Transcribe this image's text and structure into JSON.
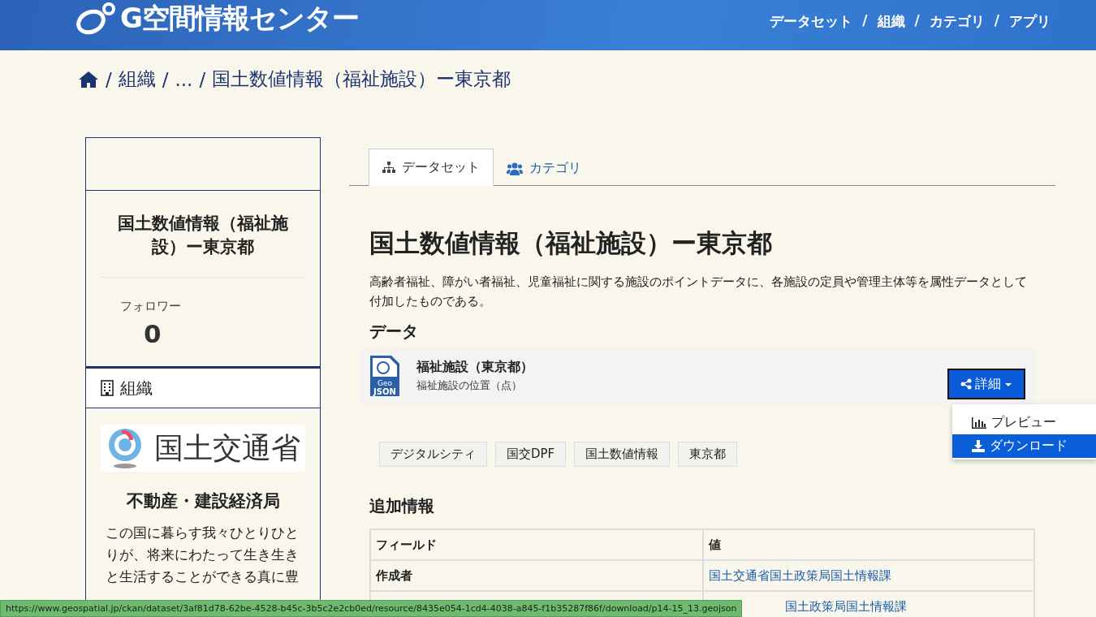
{
  "header": {
    "logo_text": "G空間情報センター",
    "nav": [
      "データセット",
      "組織",
      "カテゴリ",
      "アプリ"
    ],
    "separator": "/"
  },
  "breadcrumb": {
    "separator": "/",
    "items": [
      "組織",
      "...",
      "国土数値情報（福祉施設）ー東京都"
    ]
  },
  "sidebar": {
    "title": "国土数値情報（福祉施設）ー東京都",
    "followers_label": "フォロワー",
    "followers_count": "0",
    "org_heading": "組織",
    "org_logo_text": "国土交通省",
    "org_name": "不動産・建設経済局",
    "org_description": "この国に暮らす我々ひとりひとりが、将来にわたって生き生きと生活することができる真に豊"
  },
  "tabs": [
    {
      "label": "データセット",
      "selected": true,
      "kind": "dataset"
    },
    {
      "label": "カテゴリ",
      "selected": false,
      "kind": "category"
    }
  ],
  "dataset": {
    "title": "国土数値情報（福祉施設）ー東京都",
    "description": "高齢者福祉、障がい者福祉、児童福祉に関する施設のポイントデータに、各施設の定員や管理主体等を属性データとして付加したものである。",
    "data_heading": "データ"
  },
  "resources": [
    {
      "name": "福祉施設（東京都）",
      "description": "福祉施設の位置（点）",
      "format_label": [
        "Geo",
        "JSON"
      ],
      "button": "詳細",
      "menu": [
        {
          "label": "プレビュー",
          "kind": "preview",
          "selected": false
        },
        {
          "label": "ダウンロード",
          "kind": "download",
          "selected": true
        }
      ]
    }
  ],
  "tags": [
    "デジタルシティ",
    "国交DPF",
    "国土数値情報",
    "東京都"
  ],
  "additional_info": {
    "heading": "追加情報",
    "columns": [
      "フィールド",
      "値"
    ],
    "rows": [
      {
        "field": "作成者",
        "value": "国土交通省国土政策局国土情報課"
      },
      {
        "value": "国土政策局国土情報課"
      }
    ]
  },
  "status_url": "https://www.geospatial.jp/ckan/dataset/3af81d78-62be-4528-b45c-3b5c2e2cb0ed/resource/8435e054-1cd4-4038-a845-f1b35287f86f/download/p14-15_13.geojson"
}
